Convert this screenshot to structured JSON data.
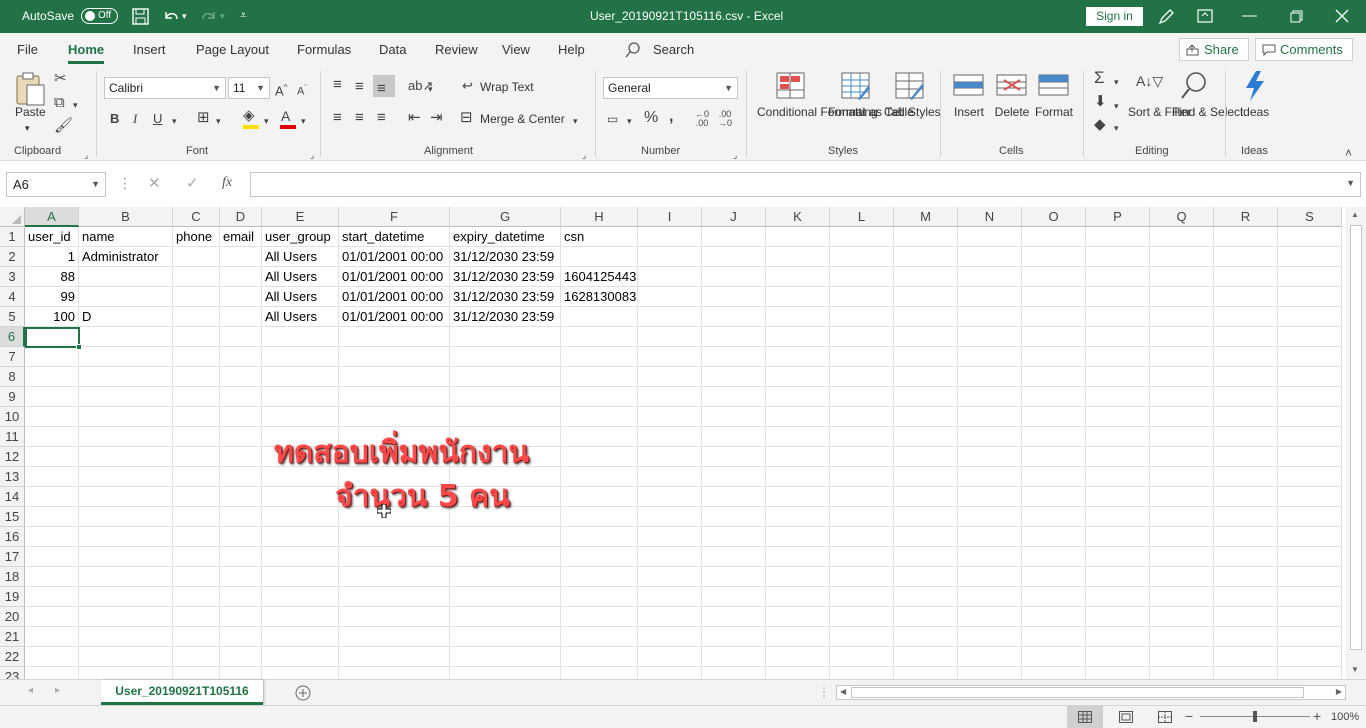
{
  "titlebar": {
    "autosave_label": "AutoSave",
    "autosave_state": "Off",
    "file_title": "User_20190921T105116.csv  -  Excel",
    "signin_label": "Sign in"
  },
  "menu": {
    "tabs": [
      "File",
      "Home",
      "Insert",
      "Page Layout",
      "Formulas",
      "Data",
      "Review",
      "View",
      "Help"
    ],
    "active_tab": "Home",
    "search_label": "Search",
    "share_label": "Share",
    "comments_label": "Comments"
  },
  "ribbon": {
    "clipboard": {
      "paste_label": "Paste",
      "group_label": "Clipboard"
    },
    "font": {
      "font_name": "Calibri",
      "font_size": "11",
      "group_label": "Font"
    },
    "alignment": {
      "wrap_text_label": "Wrap Text",
      "merge_center_label": "Merge & Center",
      "group_label": "Alignment"
    },
    "number": {
      "format": "General",
      "group_label": "Number"
    },
    "styles": {
      "conditional_formatting_label": "Conditional Formatting",
      "format_as_table_label": "Format as Table",
      "cell_styles_label": "Cell Styles",
      "group_label": "Styles"
    },
    "cells": {
      "insert_label": "Insert",
      "delete_label": "Delete",
      "format_label": "Format",
      "group_label": "Cells"
    },
    "editing": {
      "sort_filter_label": "Sort & Filter",
      "find_select_label": "Find & Select",
      "group_label": "Editing"
    },
    "ideas": {
      "ideas_label": "Ideas",
      "group_label": "Ideas"
    }
  },
  "formula_bar": {
    "name_box": "A6",
    "fx_label": "fx",
    "formula_value": ""
  },
  "sheet": {
    "columns": [
      "A",
      "B",
      "C",
      "D",
      "E",
      "F",
      "G",
      "H",
      "I",
      "J",
      "K",
      "L",
      "M",
      "N",
      "O",
      "P",
      "Q",
      "R",
      "S"
    ],
    "selected_column": "A",
    "selected_row": 6,
    "row_count": 23,
    "rows": [
      {
        "A": "user_id",
        "B": "name",
        "C": "phone",
        "D": "email",
        "E": "user_group",
        "F": "start_datetime",
        "G": "expiry_datetime",
        "H": "csn"
      },
      {
        "A": "1",
        "B": "Administrator",
        "C": "",
        "D": "",
        "E": "All Users",
        "F": "01/01/2001 00:00",
        "G": "31/12/2030 23:59",
        "H": ""
      },
      {
        "A": "88",
        "B": "",
        "C": "",
        "D": "",
        "E": "All Users",
        "F": "01/01/2001 00:00",
        "G": "31/12/2030 23:59",
        "H": "1604125443"
      },
      {
        "A": "99",
        "B": "",
        "C": "",
        "D": "",
        "E": "All Users",
        "F": "01/01/2001 00:00",
        "G": "31/12/2030 23:59",
        "H": "1628130083"
      },
      {
        "A": "100",
        "B": "D",
        "C": "",
        "D": "",
        "E": "All Users",
        "F": "01/01/2001 00:00",
        "G": "31/12/2030 23:59",
        "H": ""
      }
    ],
    "overlay_line1": "ทดสอบเพิ่มพนักงาน",
    "overlay_line2": "จำนวน 5 คน"
  },
  "sheet_tabs": {
    "active_sheet": "User_20190921T105116"
  },
  "statusbar": {
    "zoom": "100%"
  },
  "colors": {
    "accent": "#217346",
    "overlay_text": "#ff4a4a"
  }
}
